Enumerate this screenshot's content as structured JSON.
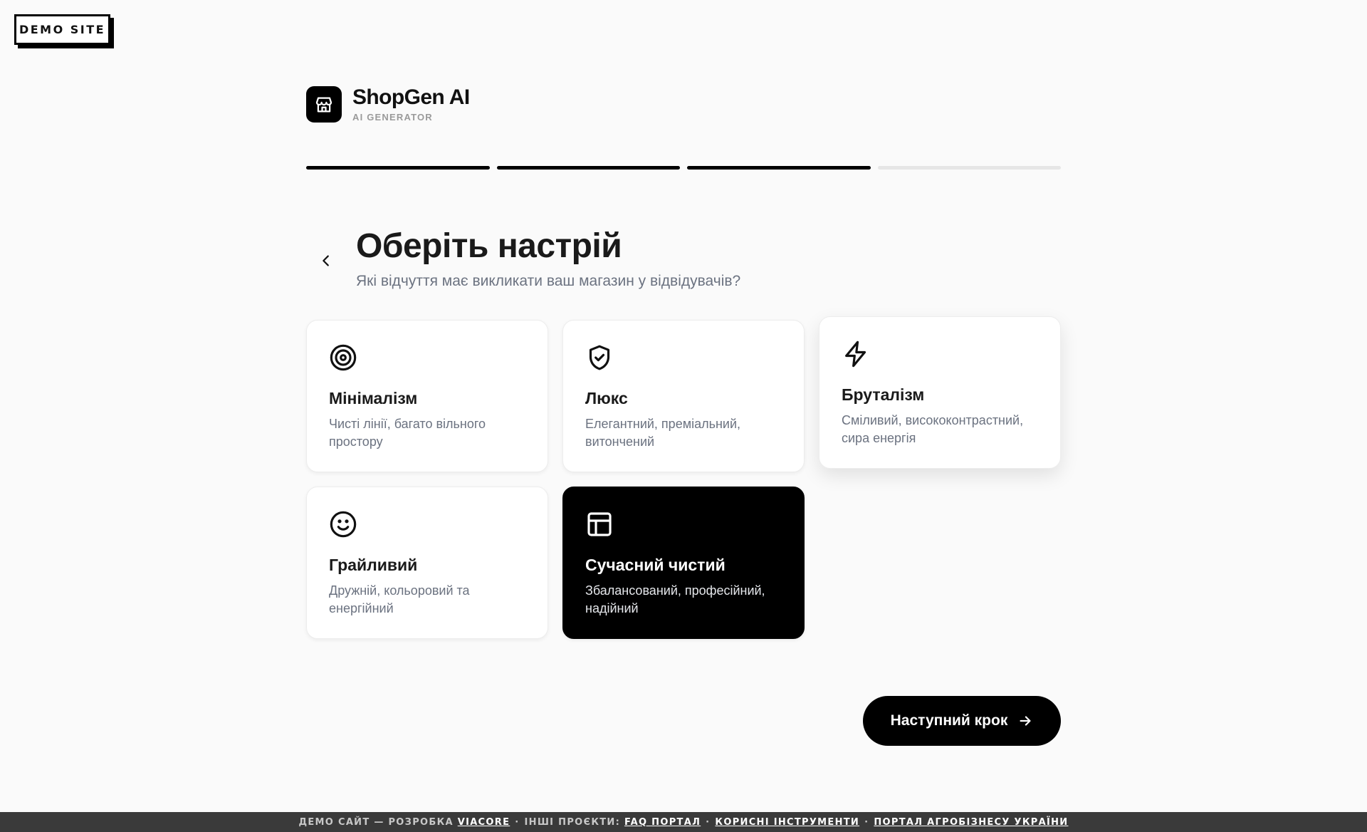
{
  "demo_badge": "DEMO SITE",
  "brand": {
    "name": "ShopGen AI",
    "subtitle": "AI GENERATOR",
    "logo_icon": "storefront-icon"
  },
  "progress": {
    "total_steps": 4,
    "completed_steps": 3
  },
  "header": {
    "back_icon": "chevron-left-icon",
    "title": "Оберіть настрій",
    "subtitle": "Які відчуття має викликати ваш магазин у відвідувачів?"
  },
  "moods": [
    {
      "icon": "target-icon",
      "title": "Мінімалізм",
      "description": "Чисті лінії, багато вільного простору",
      "selected": false
    },
    {
      "icon": "shield-check-icon",
      "title": "Люкс",
      "description": "Елегантний, преміальний, витончений",
      "selected": false
    },
    {
      "icon": "lightning-icon",
      "title": "Бруталізм",
      "description": "Сміливий, висококонтрастний, сира енергія",
      "selected": false
    },
    {
      "icon": "smiley-icon",
      "title": "Грайливий",
      "description": "Дружній, кольоровий та енергійний",
      "selected": false
    },
    {
      "icon": "layout-icon",
      "title": "Сучасний чистий",
      "description": "Збалансований, професійний, надійний",
      "selected": true
    }
  ],
  "next_button": {
    "label": "Наступний крок",
    "icon": "arrow-right-icon"
  },
  "footer": {
    "prefix": "ДЕМО САЙТ — РОЗРОБКА",
    "dev_link": "VIACORE",
    "projects_label": "ІНШІ ПРОЄКТИ:",
    "links": [
      "FAQ ПОРТАЛ",
      "КОРИСНІ ІНСТРУМЕНТИ",
      "ПОРТАЛ АГРОБІЗНЕСУ УКРАЇНИ"
    ]
  },
  "colors": {
    "accent": "#000000",
    "background": "#fafafa",
    "muted_text": "#6b7280",
    "progress_track": "#e6e6e6"
  }
}
